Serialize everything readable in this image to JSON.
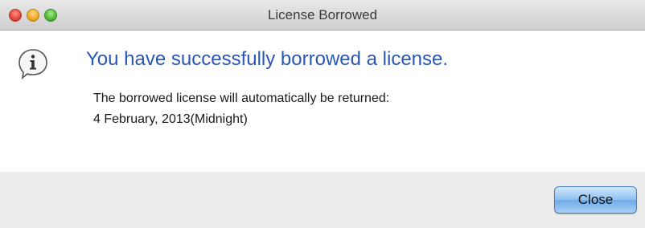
{
  "window": {
    "title": "License Borrowed"
  },
  "dialog": {
    "icon": "info-icon",
    "headline": "You have successfully borrowed a license.",
    "message_line1": "The borrowed license will automatically be returned:",
    "message_line2": "4 February, 2013(Midnight)"
  },
  "footer": {
    "close_label": "Close"
  },
  "colors": {
    "headline": "#2a56b8",
    "button_accent": "#6eaaea",
    "footer_background": "#ececec"
  }
}
